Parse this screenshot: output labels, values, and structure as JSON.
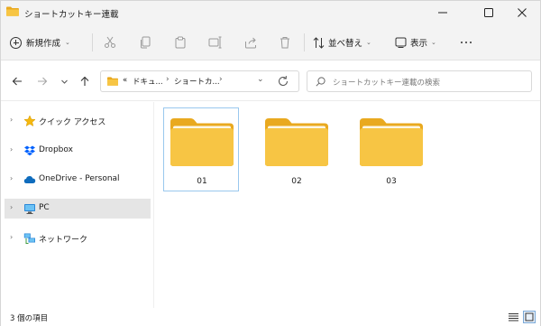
{
  "window": {
    "title": "ショートカットキー連載"
  },
  "toolbar": {
    "new_label": "新規作成",
    "sort_label": "並べ替え",
    "view_label": "表示",
    "icons": [
      "cut-icon",
      "copy-icon",
      "paste-icon",
      "rename-icon",
      "share-icon",
      "delete-icon"
    ]
  },
  "address": {
    "overflow": "«",
    "crumbs": [
      "ドキュ...",
      "ショートカ..."
    ],
    "search_placeholder": "ショートカットキー連載の検索"
  },
  "sidebar": {
    "items": [
      {
        "label": "クイック アクセス",
        "icon": "star-icon"
      },
      {
        "label": "Dropbox",
        "icon": "dropbox-icon"
      },
      {
        "label": "OneDrive - Personal",
        "icon": "cloud-icon"
      },
      {
        "label": "PC",
        "icon": "pc-icon",
        "selected": true
      },
      {
        "label": "ネットワーク",
        "icon": "network-icon"
      }
    ]
  },
  "content": {
    "folders": [
      {
        "name": "01",
        "selected": true
      },
      {
        "name": "02",
        "selected": false
      },
      {
        "name": "03",
        "selected": false
      }
    ]
  },
  "status": {
    "item_count": "3 個の項目"
  },
  "colors": {
    "folder_body": "#f7c544",
    "folder_back": "#e9a91f",
    "accent": "#0a63c9",
    "selection_border": "#99c8ee"
  }
}
